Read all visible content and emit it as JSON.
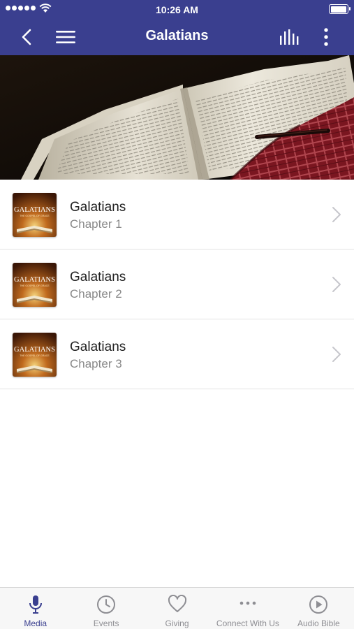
{
  "status_bar": {
    "time": "10:26 AM"
  },
  "header": {
    "title": "Galatians"
  },
  "media_list": {
    "items": [
      {
        "title": "Galatians",
        "subtitle": "Chapter 1",
        "thumb_text": "GALATIANS",
        "thumb_sub": "THE GOSPEL OF GRACE"
      },
      {
        "title": "Galatians",
        "subtitle": "Chapter 2",
        "thumb_text": "GALATIANS",
        "thumb_sub": "THE GOSPEL OF GRACE"
      },
      {
        "title": "Galatians",
        "subtitle": "Chapter 3",
        "thumb_text": "GALATIANS",
        "thumb_sub": "THE GOSPEL OF GRACE"
      }
    ]
  },
  "tab_bar": {
    "tabs": [
      {
        "label": "Media",
        "icon": "microphone-icon",
        "active": true
      },
      {
        "label": "Events",
        "icon": "clock-icon",
        "active": false
      },
      {
        "label": "Giving",
        "icon": "heart-icon",
        "active": false
      },
      {
        "label": "Connect With Us",
        "icon": "ellipsis-icon",
        "active": false
      },
      {
        "label": "Audio Bible",
        "icon": "play-circle-icon",
        "active": false
      }
    ]
  },
  "colors": {
    "accent": "#3a3f8f",
    "inactive": "#8e8e93",
    "divider": "#e3e3e3"
  }
}
